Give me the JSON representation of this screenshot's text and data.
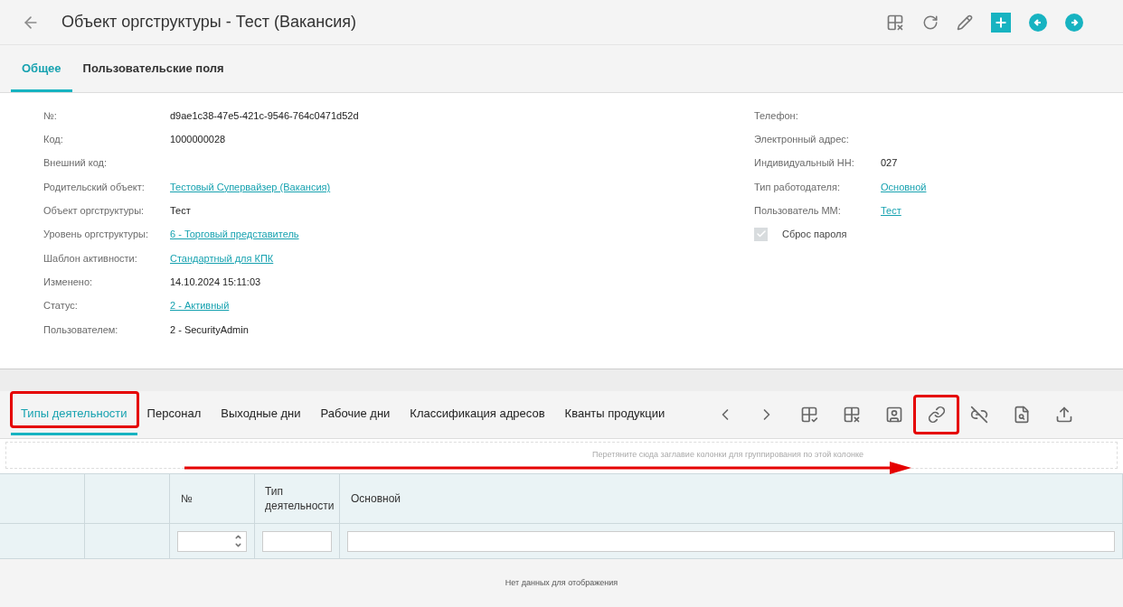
{
  "header": {
    "title": "Объект оргструктуры - Тест (Вакансия)"
  },
  "tabs": [
    {
      "label": "Общее",
      "selected": true
    },
    {
      "label": "Пользовательские поля",
      "selected": false
    }
  ],
  "fields_left": [
    {
      "label": "№:",
      "value": "d9ae1c38-47e5-421c-9546-764c0471d52d",
      "kind": "text"
    },
    {
      "label": "Код:",
      "value": "1000000028",
      "kind": "text"
    },
    {
      "label": "Внешний код:"
    },
    {
      "label": "Родительский объект:",
      "value": "Тестовый Супервайзер (Вакансия)",
      "kind": "link"
    },
    {
      "label": "Объект оргструктуры:",
      "value": "Тест",
      "kind": "text"
    },
    {
      "label": "Уровень оргструктуры:",
      "value": "6 - Торговый представитель",
      "kind": "link"
    },
    {
      "label": "Шаблон активности:",
      "value": "Стандартный для КПК",
      "kind": "link"
    },
    {
      "label": "Изменено:",
      "value": "14.10.2024 15:11:03",
      "kind": "text"
    },
    {
      "label": "Статус:",
      "value": "2 - Активный",
      "kind": "link"
    },
    {
      "label": "Пользователем:",
      "value": "2 - SecurityAdmin",
      "kind": "text"
    }
  ],
  "fields_right": [
    {
      "label": "Телефон:"
    },
    {
      "label": "Электронный адрес:"
    },
    {
      "label": "Индивидуальный НН:",
      "value": "027",
      "kind": "text"
    },
    {
      "label": "Тип работодателя:",
      "value": "Основной",
      "kind": "link"
    },
    {
      "label": "Пользователь ММ:",
      "value": "Тест",
      "kind": "link"
    }
  ],
  "password_reset": {
    "label": "Сброс пароля",
    "checked": true,
    "disabled": true
  },
  "detail_tabs": [
    {
      "label": "Типы деятельности",
      "selected": true,
      "highlighted": true
    },
    {
      "label": "Персонал",
      "selected": false,
      "highlighted": false
    },
    {
      "label": "Выходные дни",
      "selected": false,
      "highlighted": false
    },
    {
      "label": "Рабочие дни",
      "selected": false,
      "highlighted": false
    },
    {
      "label": "Классификация адресов",
      "selected": false,
      "highlighted": false
    },
    {
      "label": "Кванты продукции",
      "selected": false,
      "highlighted": false
    }
  ],
  "detail_toolbar": [
    {
      "kind": "prev",
      "highlighted": false
    },
    {
      "kind": "next",
      "highlighted": false
    },
    {
      "kind": "table-check",
      "highlighted": false
    },
    {
      "kind": "table-x",
      "highlighted": false
    },
    {
      "kind": "user-screen",
      "highlighted": false
    },
    {
      "kind": "link",
      "highlighted": true
    },
    {
      "kind": "unlink",
      "highlighted": false
    },
    {
      "kind": "doc-search",
      "highlighted": false
    },
    {
      "kind": "upload",
      "highlighted": false
    }
  ],
  "group_panel": {
    "hint": "Перетяните сюда заглавие колонки для группирования по этой колонке"
  },
  "table": {
    "columns": [
      {
        "kind": "blank"
      },
      {
        "kind": "blank"
      },
      {
        "kind": "number",
        "label": "№"
      },
      {
        "kind": "text",
        "label": "Тип деятельности"
      },
      {
        "kind": "text",
        "label": "Основной"
      }
    ],
    "empty_text": "Нет данных для отображения"
  }
}
